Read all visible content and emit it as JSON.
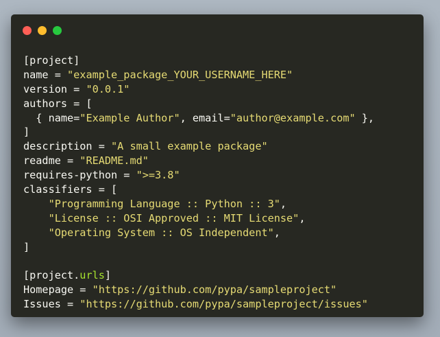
{
  "window": {
    "controls": [
      "close",
      "minimize",
      "maximize"
    ]
  },
  "colors": {
    "background": "#a7b1bc",
    "window": "#272822",
    "text": "#f8f8f2",
    "string": "#e6db74",
    "key": "#a6e22e",
    "close": "#ff5f56",
    "minimize": "#ffbd2e",
    "maximize": "#27c93f"
  },
  "code": {
    "lines": [
      [
        {
          "t": "[project]",
          "c": "plain"
        }
      ],
      [
        {
          "t": "name = ",
          "c": "plain"
        },
        {
          "t": "\"example_package_YOUR_USERNAME_HERE\"",
          "c": "str"
        }
      ],
      [
        {
          "t": "version = ",
          "c": "plain"
        },
        {
          "t": "\"0.0.1\"",
          "c": "str"
        }
      ],
      [
        {
          "t": "authors = [",
          "c": "plain"
        }
      ],
      [
        {
          "t": "  { name=",
          "c": "plain"
        },
        {
          "t": "\"Example Author\"",
          "c": "str"
        },
        {
          "t": ", email=",
          "c": "plain"
        },
        {
          "t": "\"author@example.com\"",
          "c": "str"
        },
        {
          "t": " },",
          "c": "plain"
        }
      ],
      [
        {
          "t": "]",
          "c": "plain"
        }
      ],
      [
        {
          "t": "description = ",
          "c": "plain"
        },
        {
          "t": "\"A small example package\"",
          "c": "str"
        }
      ],
      [
        {
          "t": "readme = ",
          "c": "plain"
        },
        {
          "t": "\"README.md\"",
          "c": "str"
        }
      ],
      [
        {
          "t": "requires-python = ",
          "c": "plain"
        },
        {
          "t": "\">=3.8\"",
          "c": "str"
        }
      ],
      [
        {
          "t": "classifiers = [",
          "c": "plain"
        }
      ],
      [
        {
          "t": "    ",
          "c": "plain"
        },
        {
          "t": "\"Programming Language :: Python :: 3\"",
          "c": "str"
        },
        {
          "t": ",",
          "c": "plain"
        }
      ],
      [
        {
          "t": "    ",
          "c": "plain"
        },
        {
          "t": "\"License :: OSI Approved :: MIT License\"",
          "c": "str"
        },
        {
          "t": ",",
          "c": "plain"
        }
      ],
      [
        {
          "t": "    ",
          "c": "plain"
        },
        {
          "t": "\"Operating System :: OS Independent\"",
          "c": "str"
        },
        {
          "t": ",",
          "c": "plain"
        }
      ],
      [
        {
          "t": "]",
          "c": "plain"
        }
      ],
      [
        {
          "t": "",
          "c": "plain"
        }
      ],
      [
        {
          "t": "[project.",
          "c": "plain"
        },
        {
          "t": "urls",
          "c": "key"
        },
        {
          "t": "]",
          "c": "plain"
        }
      ],
      [
        {
          "t": "Homepage = ",
          "c": "plain"
        },
        {
          "t": "\"https://github.com/pypa/sampleproject\"",
          "c": "str"
        }
      ],
      [
        {
          "t": "Issues = ",
          "c": "plain"
        },
        {
          "t": "\"https://github.com/pypa/sampleproject/issues\"",
          "c": "str"
        }
      ]
    ]
  }
}
